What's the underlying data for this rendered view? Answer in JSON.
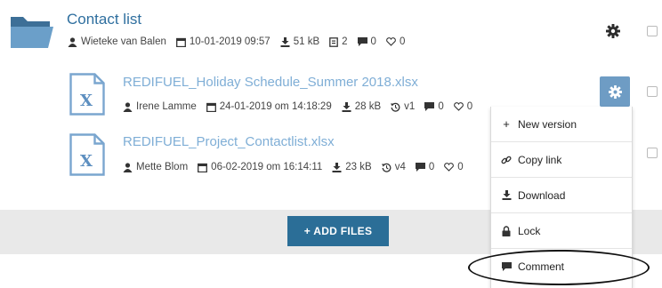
{
  "folder": {
    "title": "Contact list",
    "owner": "Wieteke van Balen",
    "date": "10-01-2019 09:57",
    "size": "51 kB",
    "files": "2",
    "comments": "0",
    "likes": "0"
  },
  "files": [
    {
      "name": "REDIFUEL_Holiday Schedule_Summer 2018.xlsx",
      "owner": "Irene Lamme",
      "date": "24-01-2019 om 14:18:29",
      "size": "28 kB",
      "version": "v1",
      "comments": "0",
      "likes": "0"
    },
    {
      "name": "REDIFUEL_Project_Contactlist.xlsx",
      "owner": "Mette Blom",
      "date": "06-02-2019 om 16:14:11",
      "size": "23 kB",
      "version": "v4",
      "comments": "0",
      "likes": "0"
    }
  ],
  "add_files": "+ ADD FILES",
  "menu": {
    "items": [
      "New version",
      "Copy link",
      "Download",
      "Lock",
      "Comment"
    ],
    "new_version_prefix": "+"
  },
  "colors": {
    "folder_title": "#2f6f9f",
    "file_title": "#7faed6",
    "gear_active_bg": "#6e9cc4",
    "add_button_bg": "#2b6e97",
    "bar_bg": "#e9e9e9"
  },
  "icons": [
    "folder-icon",
    "excel-file-icon",
    "user-icon",
    "calendar-icon",
    "download-icon",
    "files-icon",
    "comment-icon",
    "heart-icon",
    "history-icon",
    "gear-icon",
    "plus-icon",
    "link-icon",
    "lock-icon"
  ]
}
